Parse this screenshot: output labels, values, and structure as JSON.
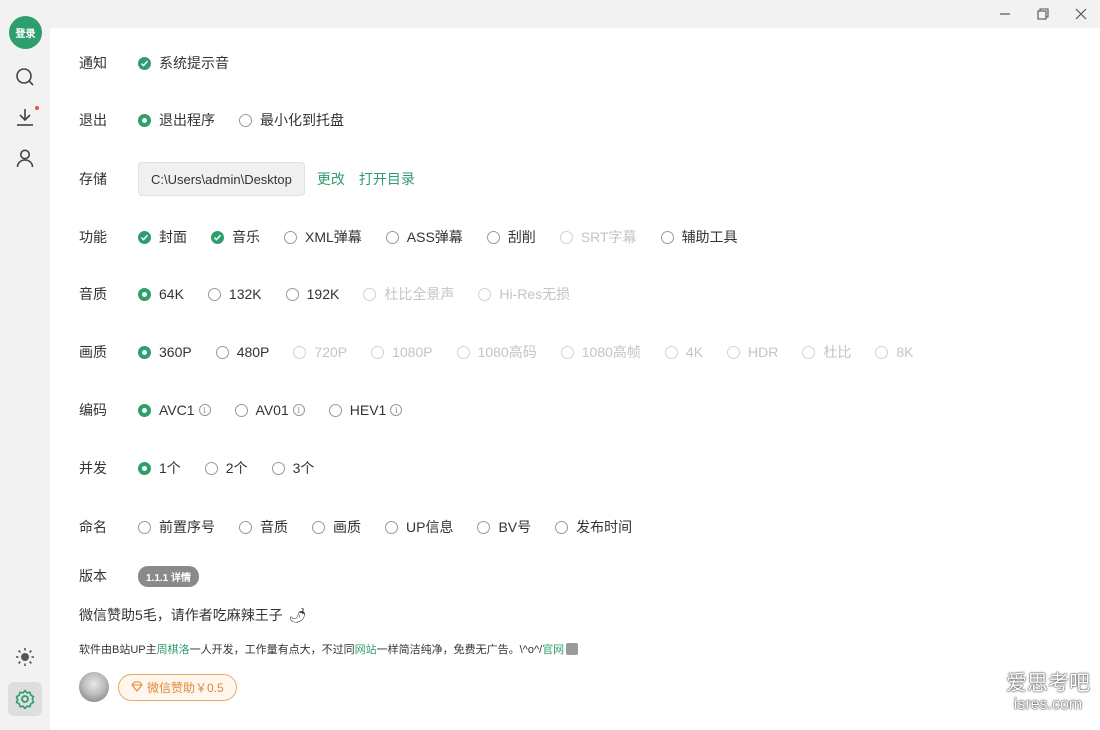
{
  "sidebar": {
    "login_label": "登录",
    "icons": [
      "search-icon",
      "download-icon",
      "user-icon",
      "theme-sun-icon",
      "settings-icon"
    ]
  },
  "window_controls": {
    "minimize": "minimize-icon",
    "maximize": "restore-icon",
    "close": "close-icon"
  },
  "settings": {
    "notify": {
      "label": "通知",
      "options": [
        {
          "label": "系统提示音",
          "checked": true
        }
      ]
    },
    "exit": {
      "label": "退出",
      "options": [
        {
          "label": "退出程序",
          "checked": true
        },
        {
          "label": "最小化到托盘",
          "checked": false
        }
      ]
    },
    "storage": {
      "label": "存储",
      "path": "C:\\Users\\admin\\Desktop",
      "change": "更改",
      "open_dir": "打开目录"
    },
    "features": {
      "label": "功能",
      "options": [
        {
          "label": "封面",
          "checked": true
        },
        {
          "label": "音乐",
          "checked": true
        },
        {
          "label": "XML弹幕",
          "checked": false
        },
        {
          "label": "ASS弹幕",
          "checked": false
        },
        {
          "label": "刮削",
          "checked": false
        },
        {
          "label": "SRT字幕",
          "checked": false,
          "disabled": true
        },
        {
          "label": "辅助工具",
          "checked": false
        }
      ]
    },
    "audio_quality": {
      "label": "音质",
      "options": [
        {
          "label": "64K",
          "checked": true
        },
        {
          "label": "132K",
          "checked": false
        },
        {
          "label": "192K",
          "checked": false
        },
        {
          "label": "杜比全景声",
          "checked": false,
          "disabled": true
        },
        {
          "label": "Hi-Res无损",
          "checked": false,
          "disabled": true
        }
      ]
    },
    "video_quality": {
      "label": "画质",
      "options": [
        {
          "label": "360P",
          "checked": true
        },
        {
          "label": "480P",
          "checked": false
        },
        {
          "label": "720P",
          "checked": false,
          "disabled": true
        },
        {
          "label": "1080P",
          "checked": false,
          "disabled": true
        },
        {
          "label": "1080高码",
          "checked": false,
          "disabled": true
        },
        {
          "label": "1080高帧",
          "checked": false,
          "disabled": true
        },
        {
          "label": "4K",
          "checked": false,
          "disabled": true
        },
        {
          "label": "HDR",
          "checked": false,
          "disabled": true
        },
        {
          "label": "杜比",
          "checked": false,
          "disabled": true
        },
        {
          "label": "8K",
          "checked": false,
          "disabled": true
        }
      ]
    },
    "codec": {
      "label": "编码",
      "options": [
        {
          "label": "AVC1",
          "checked": true
        },
        {
          "label": "AV01",
          "checked": false
        },
        {
          "label": "HEV1",
          "checked": false
        }
      ]
    },
    "concurrency": {
      "label": "并发",
      "options": [
        {
          "label": "1个",
          "checked": true
        },
        {
          "label": "2个",
          "checked": false
        },
        {
          "label": "3个",
          "checked": false
        }
      ]
    },
    "naming": {
      "label": "命名",
      "options": [
        {
          "label": "前置序号",
          "checked": false
        },
        {
          "label": "音质",
          "checked": false
        },
        {
          "label": "画质",
          "checked": false
        },
        {
          "label": "UP信息",
          "checked": false
        },
        {
          "label": "BV号",
          "checked": false
        },
        {
          "label": "发布时间",
          "checked": false
        }
      ]
    },
    "version": {
      "label": "版本",
      "badge": "1.1.1 详情"
    }
  },
  "footer": {
    "sponsor_text": "微信赞助5毛，请作者吃麻辣王子",
    "intro": {
      "p1": "软件由B站UP主",
      "author": "周棋洛",
      "p2": "一人开发，工作量有点大，不过同",
      "site": "网站",
      "p3": "一样简洁纯净，免费无广告。\\^o^/",
      "official": "官网"
    },
    "donate_button": "微信赞助￥0.5"
  },
  "watermark": {
    "line1": "爱思考吧",
    "line2": "isres.com"
  },
  "colors": {
    "accent": "#2f9e6e",
    "donate": "#e0893a",
    "disabled": "#c4c4c4"
  }
}
